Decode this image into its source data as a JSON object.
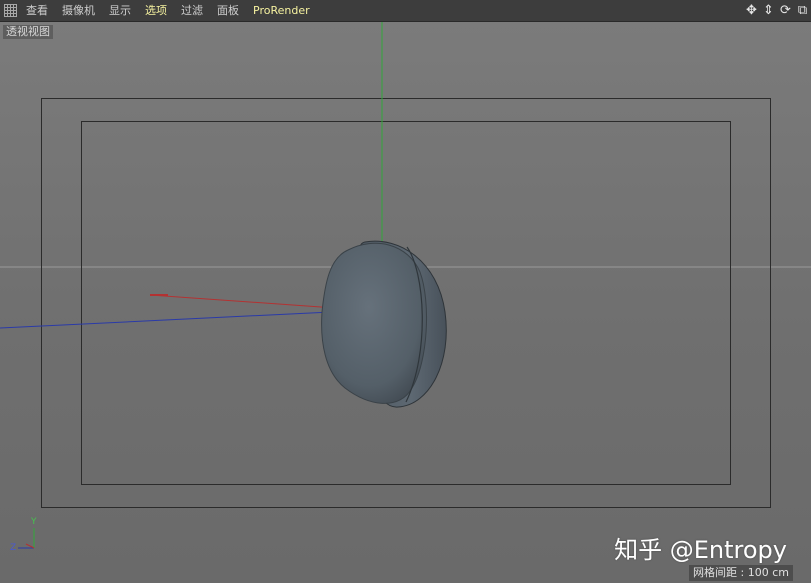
{
  "menu": {
    "items": [
      "查看",
      "摄像机",
      "显示",
      "选项",
      "过滤",
      "面板",
      "ProRender"
    ],
    "active_items": [
      "选项",
      "ProRender"
    ]
  },
  "nav_icons": [
    "move-view-icon",
    "zoom-view-icon",
    "rotate-view-icon",
    "switch-view-icon"
  ],
  "viewport": {
    "label": "透视视图",
    "grid_spacing": "网格间距 : 100 cm"
  },
  "axis_gizmo": {
    "y": "Y",
    "z": "Z"
  },
  "watermark": "知乎 @Entropy",
  "colors": {
    "x_axis": "#b33232",
    "y_axis": "#31a83a",
    "z_axis": "#2a3aa8",
    "object": "#55606a",
    "active_menu": "#f6f2a0"
  }
}
